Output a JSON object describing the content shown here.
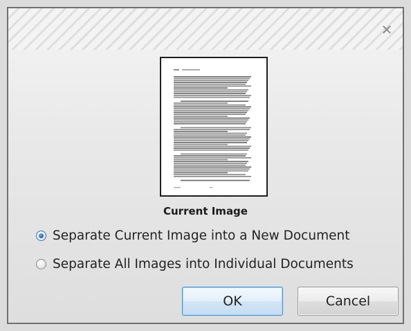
{
  "dialog": {
    "close_glyph": "✕",
    "thumbnail_caption": "Current Image",
    "options": [
      {
        "label": "Separate Current Image into a New Document",
        "selected": true
      },
      {
        "label": "Separate All Images into Individual Documents",
        "selected": false
      }
    ],
    "ok_label": "OK",
    "cancel_label": "Cancel"
  },
  "colors": {
    "accent": "#3c93d8",
    "radio_selected": "#2b68b5"
  }
}
